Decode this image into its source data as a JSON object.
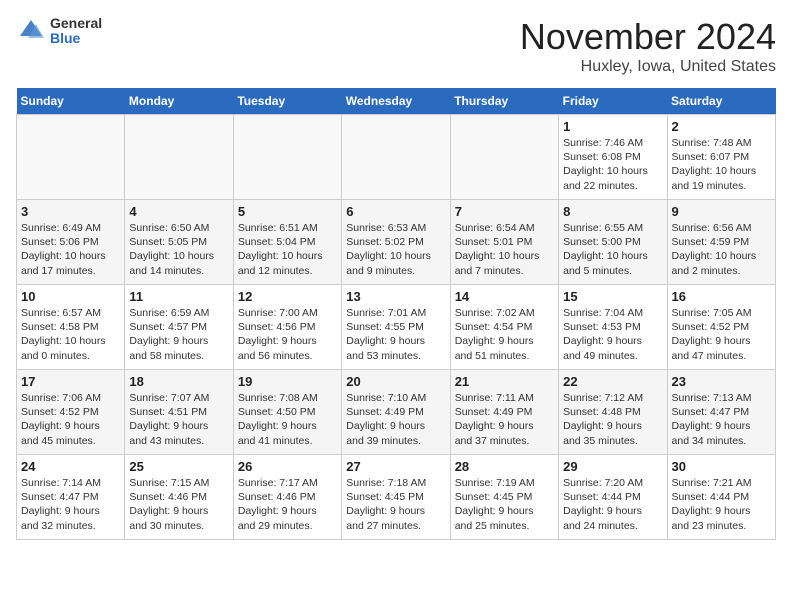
{
  "logo": {
    "general": "General",
    "blue": "Blue"
  },
  "header": {
    "month": "November 2024",
    "location": "Huxley, Iowa, United States"
  },
  "weekdays": [
    "Sunday",
    "Monday",
    "Tuesday",
    "Wednesday",
    "Thursday",
    "Friday",
    "Saturday"
  ],
  "weeks": [
    [
      {
        "day": "",
        "info": ""
      },
      {
        "day": "",
        "info": ""
      },
      {
        "day": "",
        "info": ""
      },
      {
        "day": "",
        "info": ""
      },
      {
        "day": "",
        "info": ""
      },
      {
        "day": "1",
        "info": "Sunrise: 7:46 AM\nSunset: 6:08 PM\nDaylight: 10 hours\nand 22 minutes."
      },
      {
        "day": "2",
        "info": "Sunrise: 7:48 AM\nSunset: 6:07 PM\nDaylight: 10 hours\nand 19 minutes."
      }
    ],
    [
      {
        "day": "3",
        "info": "Sunrise: 6:49 AM\nSunset: 5:06 PM\nDaylight: 10 hours\nand 17 minutes."
      },
      {
        "day": "4",
        "info": "Sunrise: 6:50 AM\nSunset: 5:05 PM\nDaylight: 10 hours\nand 14 minutes."
      },
      {
        "day": "5",
        "info": "Sunrise: 6:51 AM\nSunset: 5:04 PM\nDaylight: 10 hours\nand 12 minutes."
      },
      {
        "day": "6",
        "info": "Sunrise: 6:53 AM\nSunset: 5:02 PM\nDaylight: 10 hours\nand 9 minutes."
      },
      {
        "day": "7",
        "info": "Sunrise: 6:54 AM\nSunset: 5:01 PM\nDaylight: 10 hours\nand 7 minutes."
      },
      {
        "day": "8",
        "info": "Sunrise: 6:55 AM\nSunset: 5:00 PM\nDaylight: 10 hours\nand 5 minutes."
      },
      {
        "day": "9",
        "info": "Sunrise: 6:56 AM\nSunset: 4:59 PM\nDaylight: 10 hours\nand 2 minutes."
      }
    ],
    [
      {
        "day": "10",
        "info": "Sunrise: 6:57 AM\nSunset: 4:58 PM\nDaylight: 10 hours\nand 0 minutes."
      },
      {
        "day": "11",
        "info": "Sunrise: 6:59 AM\nSunset: 4:57 PM\nDaylight: 9 hours\nand 58 minutes."
      },
      {
        "day": "12",
        "info": "Sunrise: 7:00 AM\nSunset: 4:56 PM\nDaylight: 9 hours\nand 56 minutes."
      },
      {
        "day": "13",
        "info": "Sunrise: 7:01 AM\nSunset: 4:55 PM\nDaylight: 9 hours\nand 53 minutes."
      },
      {
        "day": "14",
        "info": "Sunrise: 7:02 AM\nSunset: 4:54 PM\nDaylight: 9 hours\nand 51 minutes."
      },
      {
        "day": "15",
        "info": "Sunrise: 7:04 AM\nSunset: 4:53 PM\nDaylight: 9 hours\nand 49 minutes."
      },
      {
        "day": "16",
        "info": "Sunrise: 7:05 AM\nSunset: 4:52 PM\nDaylight: 9 hours\nand 47 minutes."
      }
    ],
    [
      {
        "day": "17",
        "info": "Sunrise: 7:06 AM\nSunset: 4:52 PM\nDaylight: 9 hours\nand 45 minutes."
      },
      {
        "day": "18",
        "info": "Sunrise: 7:07 AM\nSunset: 4:51 PM\nDaylight: 9 hours\nand 43 minutes."
      },
      {
        "day": "19",
        "info": "Sunrise: 7:08 AM\nSunset: 4:50 PM\nDaylight: 9 hours\nand 41 minutes."
      },
      {
        "day": "20",
        "info": "Sunrise: 7:10 AM\nSunset: 4:49 PM\nDaylight: 9 hours\nand 39 minutes."
      },
      {
        "day": "21",
        "info": "Sunrise: 7:11 AM\nSunset: 4:49 PM\nDaylight: 9 hours\nand 37 minutes."
      },
      {
        "day": "22",
        "info": "Sunrise: 7:12 AM\nSunset: 4:48 PM\nDaylight: 9 hours\nand 35 minutes."
      },
      {
        "day": "23",
        "info": "Sunrise: 7:13 AM\nSunset: 4:47 PM\nDaylight: 9 hours\nand 34 minutes."
      }
    ],
    [
      {
        "day": "24",
        "info": "Sunrise: 7:14 AM\nSunset: 4:47 PM\nDaylight: 9 hours\nand 32 minutes."
      },
      {
        "day": "25",
        "info": "Sunrise: 7:15 AM\nSunset: 4:46 PM\nDaylight: 9 hours\nand 30 minutes."
      },
      {
        "day": "26",
        "info": "Sunrise: 7:17 AM\nSunset: 4:46 PM\nDaylight: 9 hours\nand 29 minutes."
      },
      {
        "day": "27",
        "info": "Sunrise: 7:18 AM\nSunset: 4:45 PM\nDaylight: 9 hours\nand 27 minutes."
      },
      {
        "day": "28",
        "info": "Sunrise: 7:19 AM\nSunset: 4:45 PM\nDaylight: 9 hours\nand 25 minutes."
      },
      {
        "day": "29",
        "info": "Sunrise: 7:20 AM\nSunset: 4:44 PM\nDaylight: 9 hours\nand 24 minutes."
      },
      {
        "day": "30",
        "info": "Sunrise: 7:21 AM\nSunset: 4:44 PM\nDaylight: 9 hours\nand 23 minutes."
      }
    ]
  ]
}
